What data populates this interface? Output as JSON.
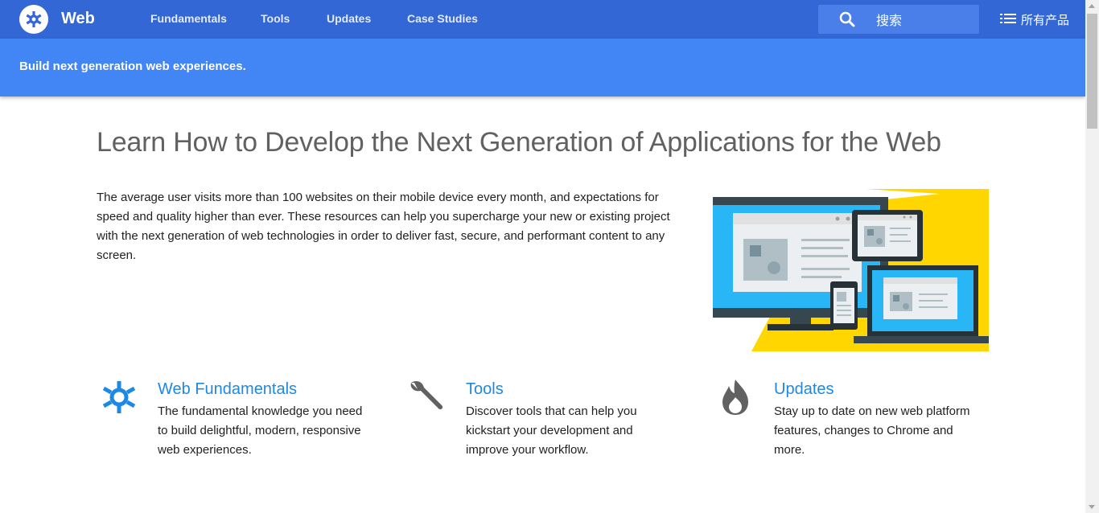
{
  "header": {
    "brand": "Web",
    "nav": [
      "Fundamentals",
      "Tools",
      "Updates",
      "Case Studies"
    ],
    "search_placeholder": "搜索",
    "products_label": "所有产品"
  },
  "subheader": {
    "tagline": "Build next generation web experiences."
  },
  "main": {
    "title": "Learn How to Develop the Next Generation of Applications for the Web",
    "intro": "The average user visits more than 100 websites on their mobile device every month, and expectations for speed and quality higher than ever. These resources can help you supercharge your new or existing project with the next generation of web technologies in order to deliver fast, secure, and performant content to any screen."
  },
  "features": [
    {
      "title": "Web Fundamentals",
      "description": "The fundamental knowledge you need to build delightful, modern, responsive web experiences.",
      "icon": "asterisk-icon"
    },
    {
      "title": "Tools",
      "description": "Discover tools that can help you kickstart your development and improve your workflow.",
      "icon": "wrench-icon"
    },
    {
      "title": "Updates",
      "description": "Stay up to date on new web platform features, changes to Chrome and more.",
      "icon": "flame-icon"
    }
  ],
  "colors": {
    "topbar": "#3367d6",
    "subheader": "#4285f4",
    "link": "#1e88e5",
    "hero_yellow": "#ffd600",
    "hero_blue": "#29b6f6"
  }
}
